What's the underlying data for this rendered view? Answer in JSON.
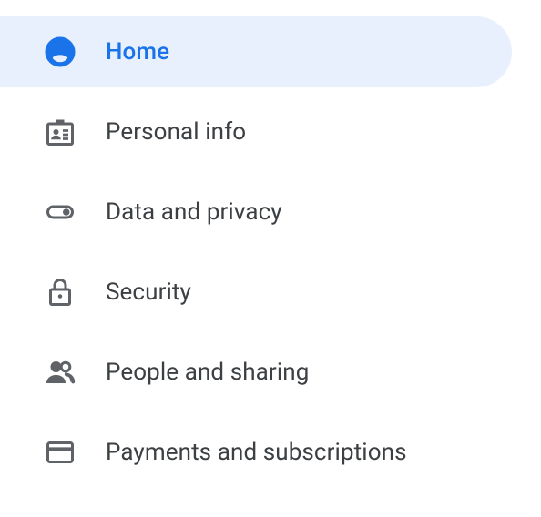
{
  "sidebar": {
    "items": [
      {
        "label": "Home",
        "selected": true,
        "icon": "account-circle-icon"
      },
      {
        "label": "Personal info",
        "selected": false,
        "icon": "badge-icon"
      },
      {
        "label": "Data and privacy",
        "selected": false,
        "icon": "toggle-icon"
      },
      {
        "label": "Security",
        "selected": false,
        "icon": "lock-icon"
      },
      {
        "label": "People and sharing",
        "selected": false,
        "icon": "people-icon"
      },
      {
        "label": "Payments and subscriptions",
        "selected": false,
        "icon": "credit-card-icon"
      }
    ]
  },
  "colors": {
    "selected_bg": "#e8f0fe",
    "selected_fg": "#1a73e8",
    "text": "#3c4043",
    "icon": "#5f6368"
  }
}
